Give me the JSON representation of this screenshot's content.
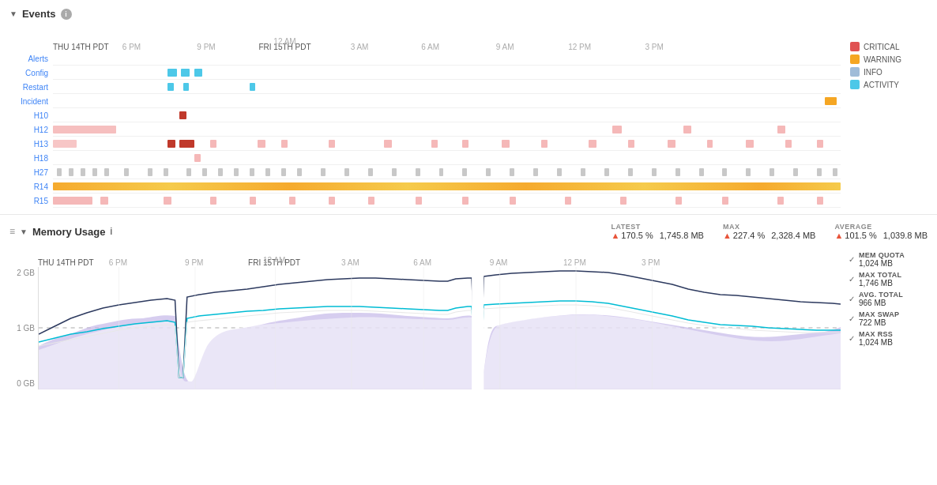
{
  "events": {
    "title": "Events",
    "legend": [
      {
        "label": "CRITICAL",
        "color": "#e05252"
      },
      {
        "label": "WARNING",
        "color": "#f5a623"
      },
      {
        "label": "INFO",
        "color": "#a0bcd8"
      },
      {
        "label": "ACTIVITY",
        "color": "#4dc8e8"
      }
    ],
    "rows": [
      {
        "label": "Alerts",
        "link": true
      },
      {
        "label": "Config",
        "link": true
      },
      {
        "label": "Restart",
        "link": true
      },
      {
        "label": "Incident",
        "link": true
      },
      {
        "label": "H10",
        "link": true
      },
      {
        "label": "H12",
        "link": true
      },
      {
        "label": "H13",
        "link": true
      },
      {
        "label": "H18",
        "link": true
      },
      {
        "label": "H27",
        "link": true
      },
      {
        "label": "R14",
        "link": true
      },
      {
        "label": "R15",
        "link": true
      }
    ],
    "time_axis": {
      "labels": [
        {
          "text": "THU 14TH PDT",
          "pct": 0,
          "primary": true
        },
        {
          "text": "6 PM",
          "pct": 8
        },
        {
          "text": "9 PM",
          "pct": 17
        },
        {
          "text": "FRI 15TH PDT",
          "pct": 26,
          "primary": true
        },
        {
          "text": "12 AM",
          "pct": 26
        },
        {
          "text": "3 AM",
          "pct": 35
        },
        {
          "text": "6 AM",
          "pct": 44
        },
        {
          "text": "9 AM",
          "pct": 53
        },
        {
          "text": "12 PM",
          "pct": 62
        },
        {
          "text": "3 PM",
          "pct": 71
        }
      ]
    }
  },
  "memory": {
    "title": "Memory Usage",
    "stats": {
      "latest": {
        "label": "LATEST",
        "pct": "170.5 %",
        "mb": "1,745.8 MB"
      },
      "max": {
        "label": "MAX",
        "pct": "227.4 %",
        "mb": "2,328.4 MB"
      },
      "average": {
        "label": "AVERAGE",
        "pct": "101.5 %",
        "mb": "1,039.8 MB"
      }
    },
    "legend": [
      {
        "label": "MEM QUOTA",
        "value": "1,024 MB",
        "checked": true
      },
      {
        "label": "MAX TOTAL",
        "value": "1,746 MB",
        "checked": true
      },
      {
        "label": "AVG. TOTAL",
        "value": "966 MB",
        "checked": true
      },
      {
        "label": "MAX SWAP",
        "value": "722 MB",
        "checked": true
      },
      {
        "label": "MAX RSS",
        "value": "1,024 MB",
        "checked": true
      }
    ],
    "y_axis": [
      "2 GB",
      "1 GB",
      "0 GB"
    ]
  }
}
